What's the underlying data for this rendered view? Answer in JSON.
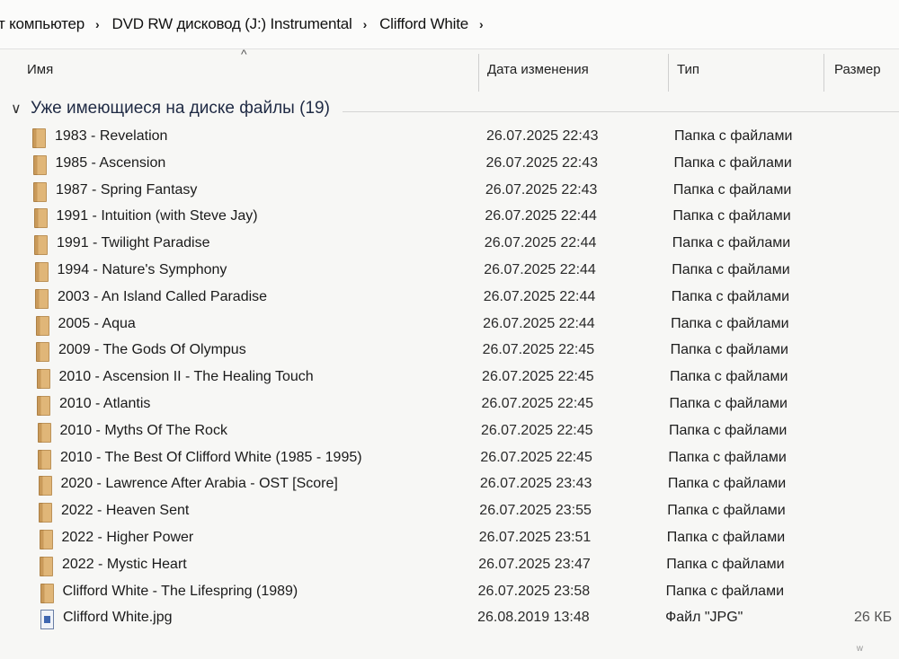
{
  "breadcrumb": {
    "items": [
      "т компьютер",
      "DVD RW дисковод (J:) Instrumental",
      "Clifford White"
    ]
  },
  "columns": {
    "name": "Имя",
    "date": "Дата изменения",
    "type": "Тип",
    "size": "Размер"
  },
  "group": {
    "label": "Уже имеющиеся на диске файлы (19)"
  },
  "rows": [
    {
      "name": "1983 - Revelation",
      "date": "26.07.2025 22:43",
      "type": "Папка с файлами",
      "icon": "folder-icon"
    },
    {
      "name": "1985 - Ascension",
      "date": "26.07.2025 22:43",
      "type": "Папка с файлами",
      "icon": "folder-icon"
    },
    {
      "name": "1987 - Spring Fantasy",
      "date": "26.07.2025 22:43",
      "type": "Папка с файлами",
      "icon": "folder-icon"
    },
    {
      "name": "1991 - Intuition (with Steve Jay)",
      "date": "26.07.2025 22:44",
      "type": "Папка с файлами",
      "icon": "folder-icon"
    },
    {
      "name": "1991 - Twilight Paradise",
      "date": "26.07.2025 22:44",
      "type": "Папка с файлами",
      "icon": "folder-icon"
    },
    {
      "name": "1994 - Nature's Symphony",
      "date": "26.07.2025 22:44",
      "type": "Папка с файлами",
      "icon": "folder-icon"
    },
    {
      "name": "2003 - An Island Called Paradise",
      "date": "26.07.2025 22:44",
      "type": "Папка с файлами",
      "icon": "folder-icon"
    },
    {
      "name": "2005 - Aqua",
      "date": "26.07.2025 22:44",
      "type": "Папка с файлами",
      "icon": "folder-icon"
    },
    {
      "name": "2009 - The Gods Of Olympus",
      "date": "26.07.2025 22:45",
      "type": "Папка с файлами",
      "icon": "folder-icon"
    },
    {
      "name": "2010 - Ascension II - The Healing Touch",
      "date": "26.07.2025 22:45",
      "type": "Папка с файлами",
      "icon": "folder-icon"
    },
    {
      "name": "2010 - Atlantis",
      "date": "26.07.2025 22:45",
      "type": "Папка с файлами",
      "icon": "folder-icon"
    },
    {
      "name": "2010 - Myths Of The Rock",
      "date": "26.07.2025 22:45",
      "type": "Папка с файлами",
      "icon": "folder-icon"
    },
    {
      "name": "2010 - The Best Of Clifford White (1985 - 1995)",
      "date": "26.07.2025 22:45",
      "type": "Папка с файлами",
      "icon": "folder-icon"
    },
    {
      "name": "2020 - Lawrence After Arabia - OST [Score]",
      "date": "26.07.2025 23:43",
      "type": "Папка с файлами",
      "icon": "folder-icon"
    },
    {
      "name": "2022 - Heaven Sent",
      "date": "26.07.2025 23:55",
      "type": "Папка с файлами",
      "icon": "folder-icon"
    },
    {
      "name": "2022 - Higher Power",
      "date": "26.07.2025 23:51",
      "type": "Папка с файлами",
      "icon": "folder-icon"
    },
    {
      "name": "2022 - Mystic Heart",
      "date": "26.07.2025 23:47",
      "type": "Папка с файлами",
      "icon": "folder-icon"
    },
    {
      "name": "Clifford White - The Lifespring (1989)",
      "date": "26.07.2025 23:58",
      "type": "Папка с файлами",
      "icon": "folder-icon"
    },
    {
      "name": "Clifford White.jpg",
      "date": "26.08.2019 13:48",
      "type": "Файл \"JPG\"",
      "size": "26 КБ",
      "icon": "image-icon"
    }
  ]
}
